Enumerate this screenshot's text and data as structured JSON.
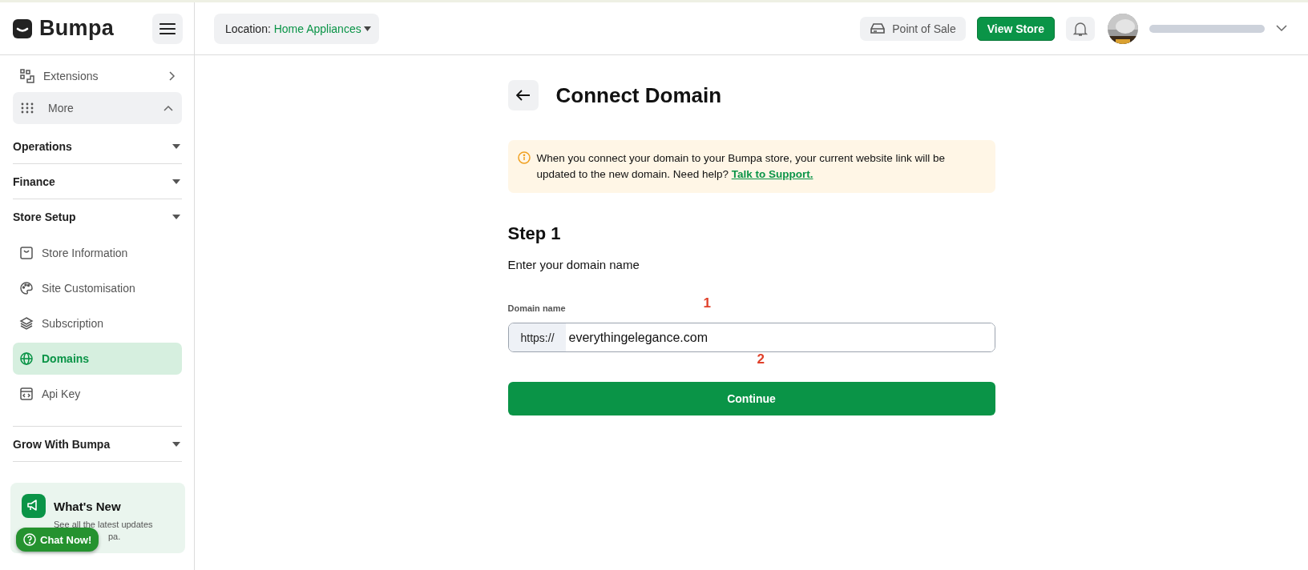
{
  "brand": {
    "name": "Bumpa"
  },
  "location": {
    "label": "Location:",
    "value": "Home Appliances"
  },
  "header_actions": {
    "point_of_sale": "Point of Sale",
    "view_store": "View Store"
  },
  "sidebar": {
    "top_items": [
      {
        "label": "Extensions",
        "kind": "link"
      },
      {
        "label": "More",
        "kind": "toggle",
        "expanded": true
      }
    ],
    "sections": [
      {
        "label": "Operations"
      },
      {
        "label": "Finance"
      },
      {
        "label": "Store Setup",
        "children": [
          {
            "label": "Store Information",
            "selected": false
          },
          {
            "label": "Site Customisation",
            "selected": false
          },
          {
            "label": "Subscription",
            "selected": false
          },
          {
            "label": "Domains",
            "selected": true
          },
          {
            "label": "Api Key",
            "selected": false
          }
        ]
      },
      {
        "label": "Grow With Bumpa"
      }
    ],
    "promo": {
      "title": "What's New",
      "line_1": "See all the latest updates",
      "line_2": "pa."
    },
    "chat_button": "Chat Now!"
  },
  "page": {
    "title": "Connect Domain",
    "notice": {
      "text": "When you connect your domain to your Bumpa store, your current website link will be updated to the new domain. Need help?",
      "link": "Talk to Support."
    },
    "step_title": "Step 1",
    "step_text": "Enter your domain name",
    "field": {
      "label": "Domain name",
      "prefix": "https://",
      "value": "everythingelegance.com"
    },
    "button": "Continue"
  },
  "markers": [
    {
      "label": "1"
    },
    {
      "label": "2"
    }
  ]
}
